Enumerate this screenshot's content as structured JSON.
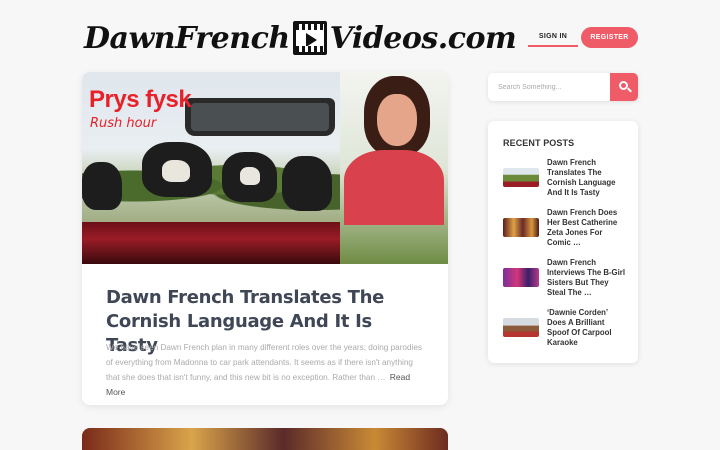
{
  "site": {
    "logo_text_left": "DawnFrench",
    "logo_text_right": "Videos.com",
    "logo_icon": "film-play-icon"
  },
  "header": {
    "signin_label": "SIGN IN",
    "register_label": "REGISTER"
  },
  "featured": {
    "image_text_title": "Prys fysk",
    "image_text_subtitle": "Rush hour",
    "title": "Dawn French Translates The Cornish Language And It Is Tasty",
    "excerpt": "We have seen Dawn French plan in many different roles over the years; doing parodies of everything from Madonna to car park attendants. It seems as if there isn't anything that she does that isn't funny, and this new bit is no exception. Rather than …",
    "read_more": "Read More"
  },
  "search": {
    "placeholder": "Search Something...",
    "icon": "search-icon"
  },
  "recent_posts": {
    "heading": "RECENT POSTS",
    "items": [
      {
        "title": "Dawn French Translates The Cornish Language And It Is Tasty"
      },
      {
        "title": "Dawn French Does Her Best Catherine Zeta Jones For Comic …"
      },
      {
        "title": "Dawn French Interviews The B-Girl Sisters But They Steal The …"
      },
      {
        "title": "‘Dawnie Corden’ Does A Brilliant Spoof Of Carpool Karaoke"
      }
    ]
  },
  "colors": {
    "accent": "#ef5b67",
    "title_text": "#3f4756",
    "muted_text": "#aaaaaa"
  }
}
